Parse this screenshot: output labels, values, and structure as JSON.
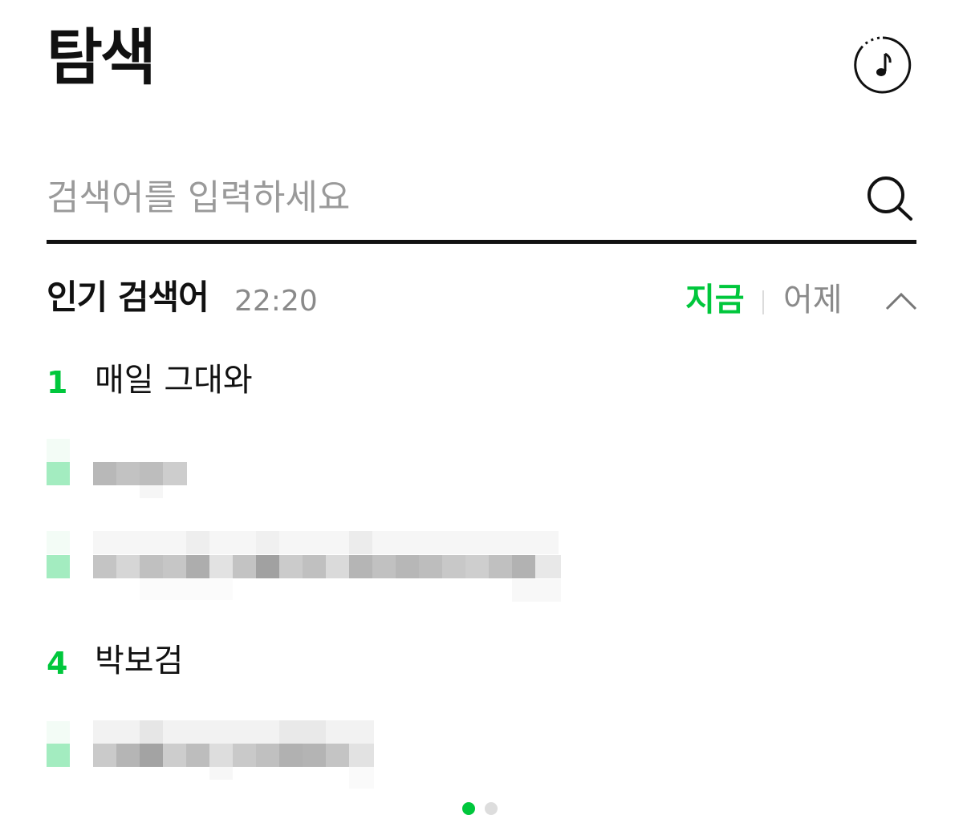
{
  "header": {
    "title": "탐색",
    "music_icon": "music-note-icon"
  },
  "search": {
    "placeholder": "검색어를 입력하세요",
    "icon": "search-icon"
  },
  "popular": {
    "title": "인기 검색어",
    "time": "22:20",
    "tabs": {
      "now": "지금",
      "yesterday": "어제"
    },
    "collapse_icon": "chevron-up-icon",
    "items": [
      {
        "rank": "1",
        "term": "매일 그대와"
      },
      {
        "rank": "",
        "term": ""
      },
      {
        "rank": "",
        "term": ""
      },
      {
        "rank": "4",
        "term": "박보검"
      },
      {
        "rank": "",
        "term": ""
      }
    ]
  },
  "colors": {
    "accent": "#00c73c",
    "text": "#111111",
    "muted": "#8a8a8a",
    "blur_rank": "#a3ecc0"
  },
  "pager": {
    "active_index": 0,
    "count": 2
  }
}
